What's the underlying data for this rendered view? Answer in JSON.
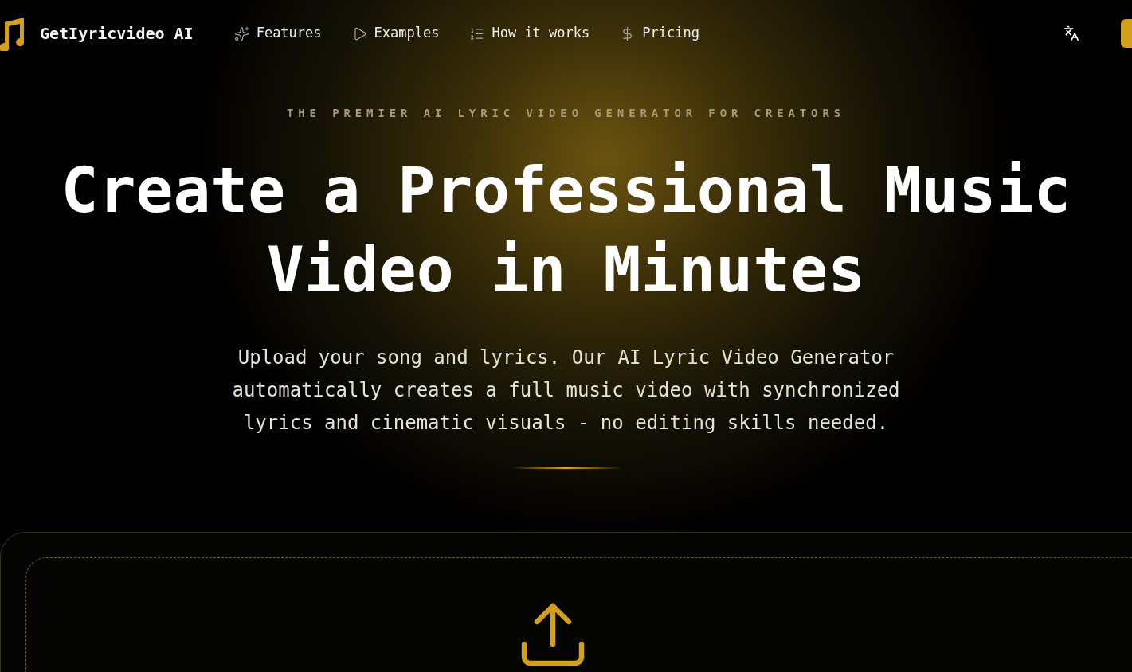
{
  "header": {
    "brand": "GetIyricvideo AI",
    "nav": [
      {
        "label": "Features",
        "kind": "sparkles"
      },
      {
        "label": "Examples",
        "kind": "play"
      },
      {
        "label": "How it works",
        "kind": "list"
      },
      {
        "label": "Pricing",
        "kind": "dollar"
      }
    ]
  },
  "hero": {
    "eyebrow": "THE PREMIER AI LYRIC VIDEO GENERATOR FOR CREATORS",
    "headline": [
      "Create a Professional Music",
      "Video in Minutes"
    ],
    "description": "Upload your song and lyrics. Our AI Lyric Video Generator automatically creates a full music video with synchronized lyrics and cinematic visuals - no editing skills needed."
  }
}
